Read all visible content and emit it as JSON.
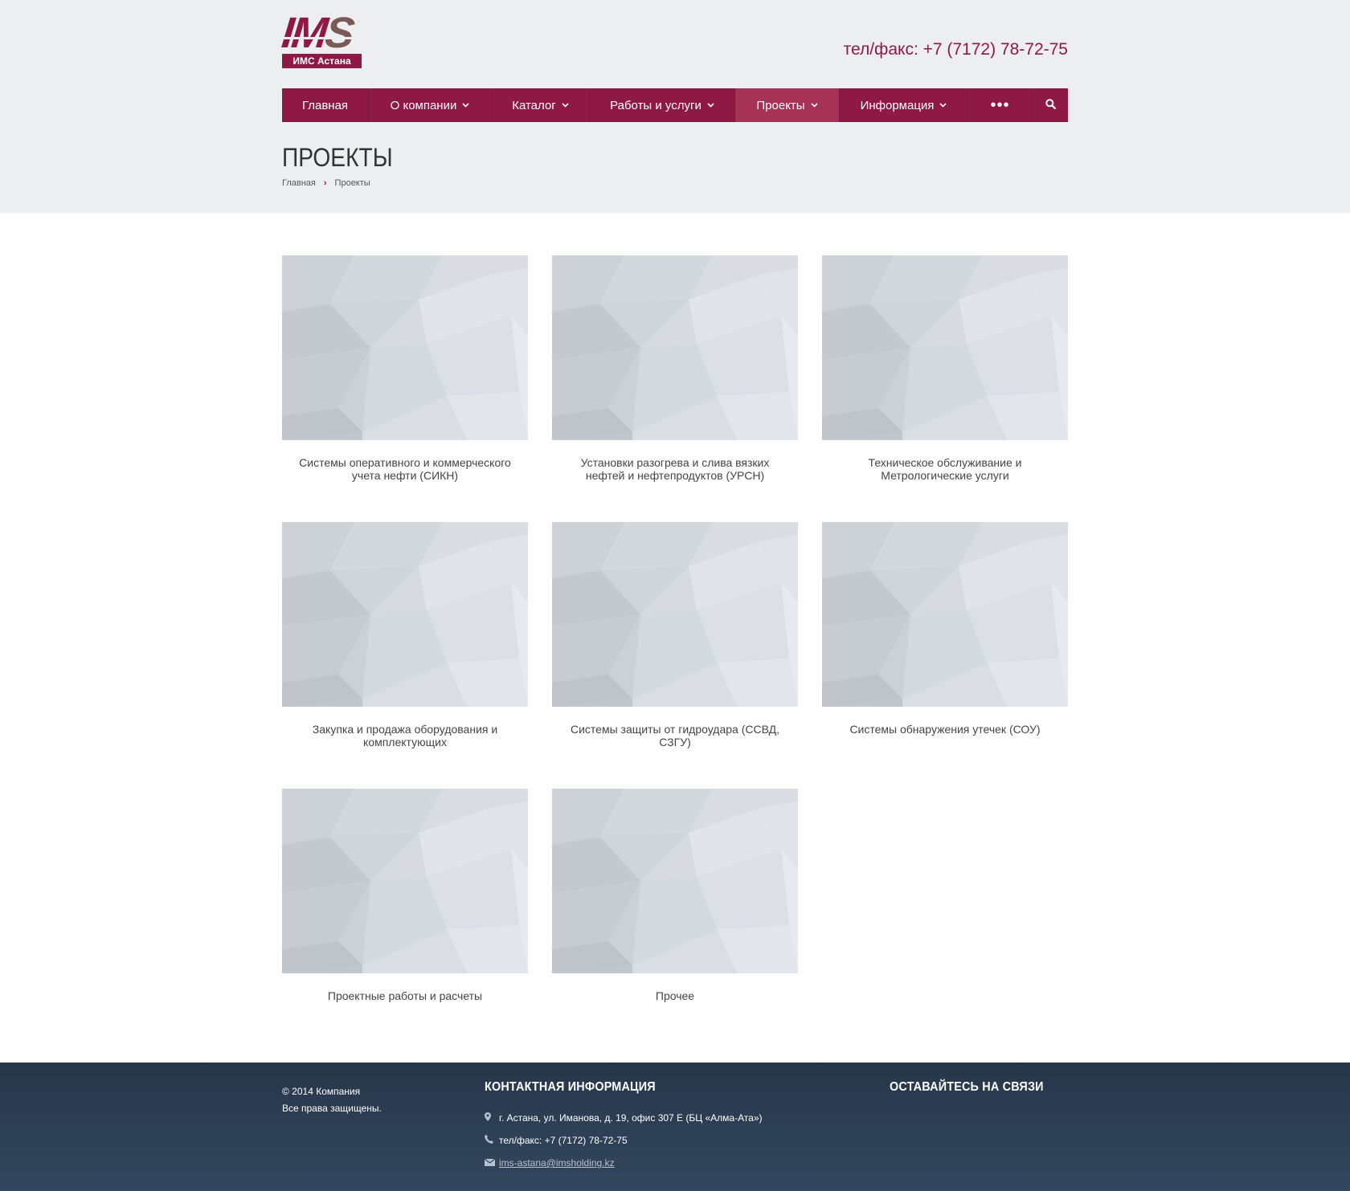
{
  "header": {
    "logo_text_a": "IM",
    "logo_text_b": "S",
    "logo_subtitle": "ИМС Астана",
    "phone": "тел/факс: +7 (7172) 78-72-75"
  },
  "nav": {
    "items": [
      {
        "label": "Главная",
        "dropdown": false
      },
      {
        "label": "О компании",
        "dropdown": true
      },
      {
        "label": "Каталог",
        "dropdown": true
      },
      {
        "label": "Работы и услуги",
        "dropdown": true
      },
      {
        "label": "Проекты",
        "dropdown": true,
        "active": true
      },
      {
        "label": "Информация",
        "dropdown": true
      }
    ],
    "more_label": "•••",
    "chevron": "⌄"
  },
  "page": {
    "title": "ПРОЕКТЫ",
    "breadcrumb": [
      {
        "label": "Главная"
      },
      {
        "label": "Проекты"
      }
    ],
    "breadcrumb_sep": "›"
  },
  "projects": [
    {
      "caption": "Системы оперативного и коммерческого учета нефти (СИКН)"
    },
    {
      "caption": "Установки разогрева и слива вязких нефтей и нефтепродуктов (УРСН)"
    },
    {
      "caption": "Техническое обслуживание и Метрологические услуги"
    },
    {
      "caption": "Закупка и продажа оборудования и комплектующих"
    },
    {
      "caption": "Системы защиты от гидроудара (ССВД, СЗГУ)"
    },
    {
      "caption": "Системы обнаружения утечек (СОУ)"
    },
    {
      "caption": "Проектные работы и расчеты"
    },
    {
      "caption": "Прочее"
    }
  ],
  "footer": {
    "copyright_line1": "© 2014 Компания",
    "copyright_line2": "Все права защищены.",
    "contact_title": "КОНТАКТНАЯ ИНФОРМАЦИЯ",
    "address": "г. Астана, ул. Иманова, д. 19, офис 307 Е (БЦ «Алма-Ата»)",
    "phone": "тел/факс: +7 (7172) 78-72-75",
    "email": "ims-astana@imsholding.kz",
    "social_title": "ОСТАВАЙТЕСЬ НА СВЯЗИ"
  },
  "colors": {
    "brand": "#8e1a44",
    "nav_active": "#a63258",
    "footer": "#2e4055"
  }
}
